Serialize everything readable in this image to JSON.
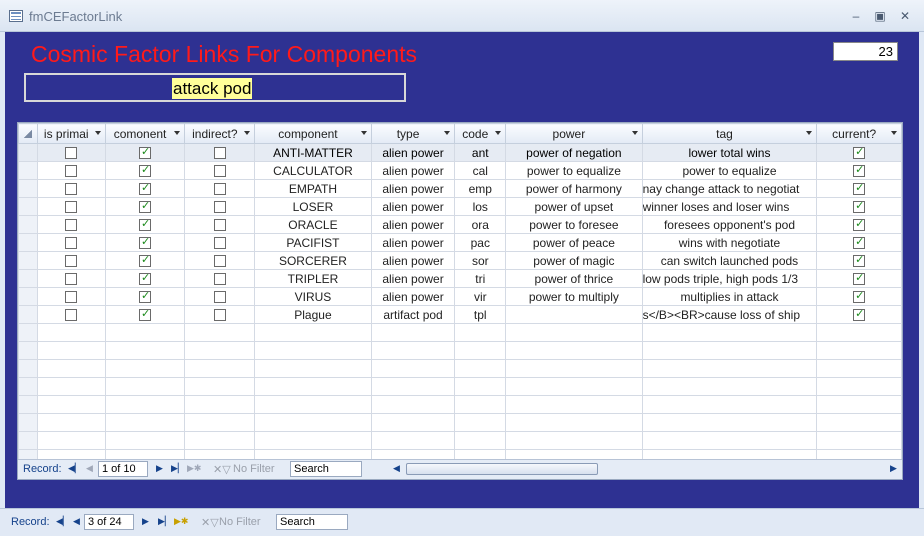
{
  "window": {
    "title": "fmCEFactorLink"
  },
  "form": {
    "title": "Cosmic Factor Links For Components",
    "count": "23",
    "factor_name": "attack pod"
  },
  "columns": [
    "is primai",
    "comonent",
    "indirect?",
    "component",
    "type",
    "code",
    "power",
    "tag",
    "current?"
  ],
  "rows": [
    {
      "is_primary": false,
      "comonent": true,
      "indirect": false,
      "component": "ANTI-MATTER",
      "type": "alien power",
      "code": "ant",
      "power": "power of negation",
      "tag": "lower total wins",
      "current": true
    },
    {
      "is_primary": false,
      "comonent": true,
      "indirect": false,
      "component": "CALCULATOR",
      "type": "alien power",
      "code": "cal",
      "power": "power to equalize",
      "tag": "power to equalize",
      "current": true
    },
    {
      "is_primary": false,
      "comonent": true,
      "indirect": false,
      "component": "EMPATH",
      "type": "alien power",
      "code": "emp",
      "power": "power of harmony",
      "tag": "nay change attack to negotiat",
      "current": true
    },
    {
      "is_primary": false,
      "comonent": true,
      "indirect": false,
      "component": "LOSER",
      "type": "alien power",
      "code": "los",
      "power": "power of upset",
      "tag": "winner loses and loser wins",
      "current": true
    },
    {
      "is_primary": false,
      "comonent": true,
      "indirect": false,
      "component": "ORACLE",
      "type": "alien power",
      "code": "ora",
      "power": "power to foresee",
      "tag": "foresees opponent's pod",
      "current": true
    },
    {
      "is_primary": false,
      "comonent": true,
      "indirect": false,
      "component": "PACIFIST",
      "type": "alien power",
      "code": "pac",
      "power": "power of peace",
      "tag": "wins with negotiate",
      "current": true
    },
    {
      "is_primary": false,
      "comonent": true,
      "indirect": false,
      "component": "SORCERER",
      "type": "alien power",
      "code": "sor",
      "power": "power of magic",
      "tag": "can switch launched pods",
      "current": true
    },
    {
      "is_primary": false,
      "comonent": true,
      "indirect": false,
      "component": "TRIPLER",
      "type": "alien power",
      "code": "tri",
      "power": "power of thrice",
      "tag": "low pods triple,  high pods 1/3",
      "current": true
    },
    {
      "is_primary": false,
      "comonent": true,
      "indirect": false,
      "component": "VIRUS",
      "type": "alien power",
      "code": "vir",
      "power": "power to multiply",
      "tag": "multiplies in attack",
      "current": true
    },
    {
      "is_primary": false,
      "comonent": true,
      "indirect": false,
      "component": "Plague",
      "type": "artifact pod",
      "code": "tpl",
      "power": "",
      "tag": "s</B><BR>cause loss of ship",
      "current": true
    }
  ],
  "subform_nav": {
    "record_label": "Record:",
    "record_value": "1 of 10",
    "no_filter": "No Filter",
    "search": "Search"
  },
  "main_nav": {
    "record_label": "Record:",
    "record_value": "3 of 24",
    "no_filter": "No Filter",
    "search": "Search"
  },
  "colors": {
    "form_bg": "#2e3192",
    "title_red": "#ff1a1a",
    "highlight_yellow": "#ffff99"
  },
  "icons": [
    "minimize-icon",
    "maximize-icon",
    "close-icon",
    "first-record-icon",
    "prev-record-icon",
    "next-record-icon",
    "last-record-icon",
    "new-record-icon",
    "filter-icon"
  ]
}
